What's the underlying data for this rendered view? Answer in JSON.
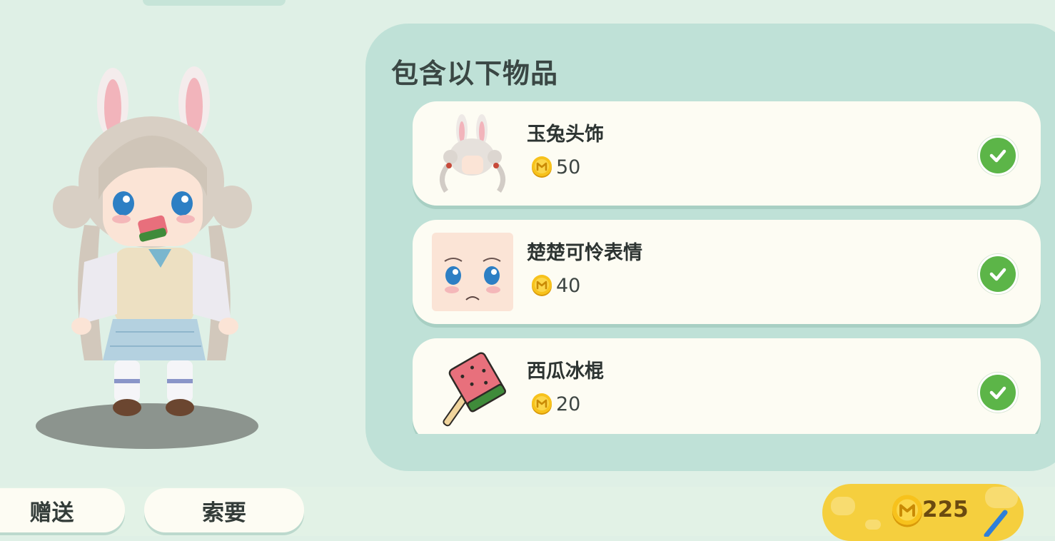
{
  "panel": {
    "title": "包含以下物品"
  },
  "items": [
    {
      "name": "玉兔头饰",
      "price": "50",
      "icon": "bunny-headwear-icon",
      "status": "owned"
    },
    {
      "name": "楚楚可怜表情",
      "price": "40",
      "icon": "pitiful-face-icon",
      "status": "owned"
    },
    {
      "name": "西瓜冰棍",
      "price": "20",
      "icon": "watermelon-popsicle-icon",
      "status": "owned"
    }
  ],
  "buttons": {
    "gift": "赠送",
    "request": "索要"
  },
  "wallet": {
    "balance": "225",
    "icon": "mini-coin-icon"
  },
  "colors": {
    "panel": "#bfe1d7",
    "card": "#fdfcf3",
    "check": "#5cb548",
    "coin": "#f5c21a",
    "background": "#dff0e6"
  }
}
